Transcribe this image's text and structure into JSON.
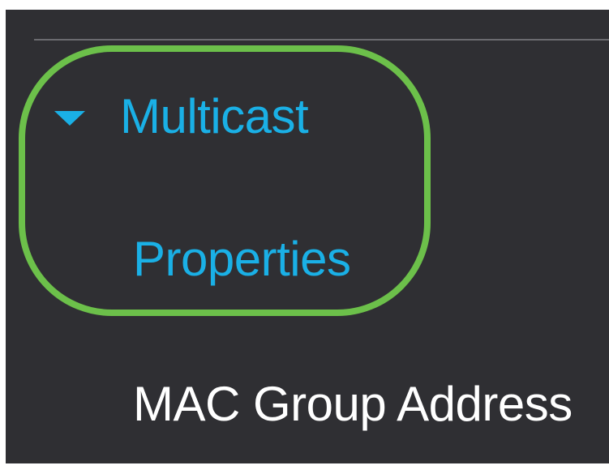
{
  "nav": {
    "multicast": {
      "label": "Multicast",
      "expanded": true,
      "items": [
        {
          "label": "Properties",
          "highlighted": true
        },
        {
          "label": "MAC Group Address"
        }
      ]
    }
  },
  "colors": {
    "background": "#2f2f33",
    "accent": "#1ab0e6",
    "highlight_ring": "#6cc04a",
    "text": "#ffffff",
    "divider": "#6b6b70"
  },
  "icons": {
    "expand": "caret-down-icon"
  }
}
